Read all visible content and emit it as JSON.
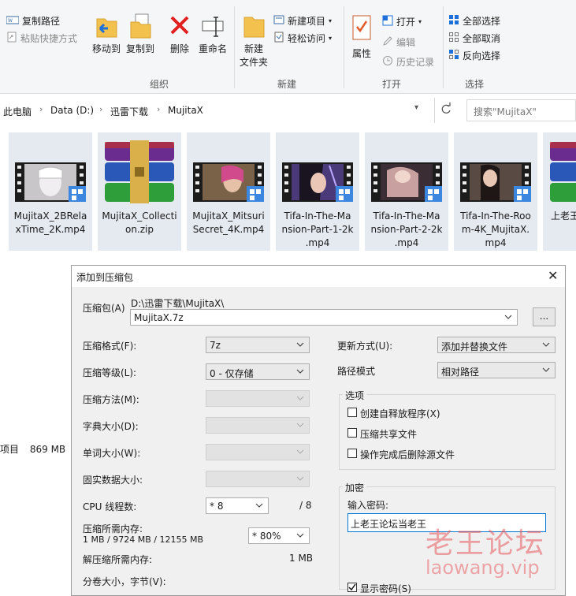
{
  "ribbon": {
    "copy_path": "复制路径",
    "paste_shortcut": "粘贴快捷方式",
    "move_to": "移动到",
    "copy_to": "复制到",
    "delete": "删除",
    "rename": "重命名",
    "new_folder_line1": "新建",
    "new_folder_line2": "文件夹",
    "new_item": "新建项目",
    "easy_access": "轻松访问",
    "properties": "属性",
    "open": "打开",
    "edit": "编辑",
    "history": "历史记录",
    "select_all": "全部选择",
    "select_none": "全部取消",
    "invert_selection": "反向选择",
    "groups": {
      "organize": "组织",
      "new": "新建",
      "open": "打开",
      "select": "选择"
    }
  },
  "address": {
    "crumbs": [
      "此电脑",
      "Data (D:)",
      "迅雷下载",
      "MujitaX"
    ],
    "search_placeholder": "搜索\"MujitaX\""
  },
  "files": [
    {
      "name_lines": [
        "MujitaX_2BRela",
        "xTime_2K.mp4"
      ],
      "kind": "video"
    },
    {
      "name_lines": [
        "MujitaX_Collecti",
        "on.zip"
      ],
      "kind": "archive"
    },
    {
      "name_lines": [
        "MujitaX_Mitsuri",
        "Secret_4K.mp4"
      ],
      "kind": "video"
    },
    {
      "name_lines": [
        "Tifa-In-The-Ma",
        "nsion-Part-1-2k",
        ".mp4"
      ],
      "kind": "video"
    },
    {
      "name_lines": [
        "Tifa-In-The-Ma",
        "nsion-Part-2-2k",
        ".mp4"
      ],
      "kind": "video"
    },
    {
      "name_lines": [
        "Tifa-In-The-Roo",
        "m-4K_MujitaX.",
        "mp4"
      ],
      "kind": "video"
    },
    {
      "name_lines": [
        "上老王"
      ],
      "kind": "archive"
    }
  ],
  "status": {
    "items_label": "项目",
    "size": "869 MB"
  },
  "dialog": {
    "title": "添加到压缩包",
    "archive_label": "压缩包(A)",
    "archive_dir": "D:\\迅雷下载\\MujitaX\\",
    "archive_name": "MujitaX.7z",
    "browse": "...",
    "format_label": "压缩格式(F):",
    "format_value": "7z",
    "level_label": "压缩等级(L):",
    "level_value": "0 - 仅存储",
    "method_label": "压缩方法(M):",
    "dict_label": "字典大小(D):",
    "word_label": "单词大小(W):",
    "solid_label": "固实数据大小:",
    "cpu_label": "CPU 线程数:",
    "cpu_value": "* 8",
    "cpu_total": "/ 8",
    "mem_label": "压缩所需内存:",
    "mem_detail": "1 MB / 9724 MB / 12155 MB",
    "mem_percent": "* 80%",
    "decomp_label": "解压缩所需内存:",
    "decomp_value": "1 MB",
    "split_label": "分卷大小，字节(V):",
    "update_label": "更新方式(U):",
    "update_value": "添加并替换文件",
    "path_label": "路径模式",
    "path_value": "相对路径",
    "options_title": "选项",
    "opt_sfx": "创建自释放程序(X)",
    "opt_shared": "压缩共享文件",
    "opt_delete": "操作完成后删除源文件",
    "encrypt_title": "加密",
    "password_label": "输入密码:",
    "password_value": "上老王论坛当老王",
    "show_password": "显示密码(S)"
  },
  "watermark": {
    "line1": "老王论坛",
    "line2": "laowang.vip"
  },
  "colors": {
    "accent": "#0078d7",
    "selection": "#e5eaf1",
    "watermark": "#e8595c"
  }
}
